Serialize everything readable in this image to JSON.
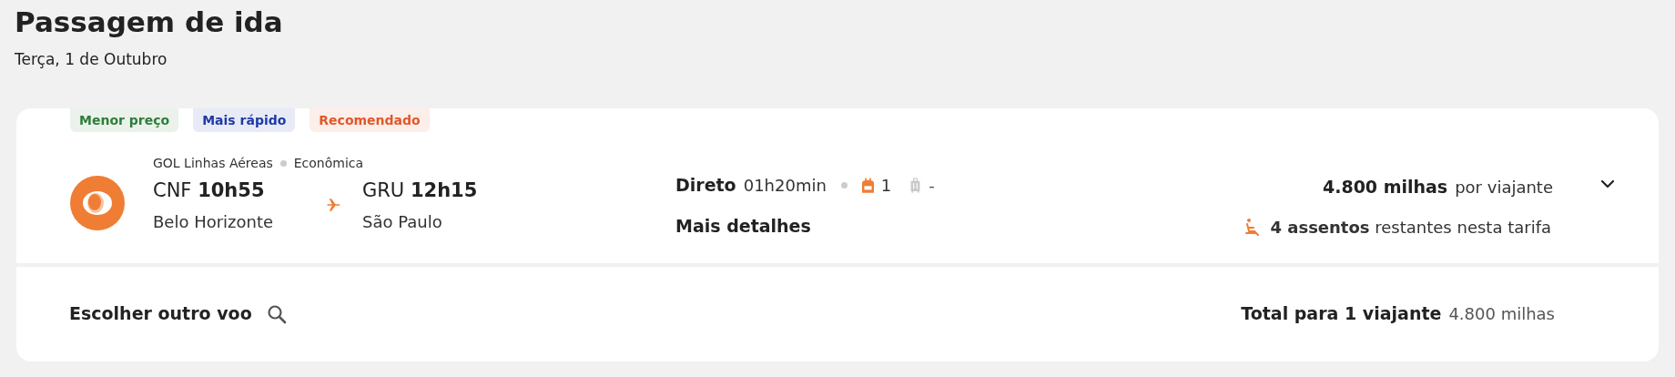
{
  "header": {
    "title": "Passagem de ida",
    "date": "Terça, 1 de Outubro"
  },
  "flight": {
    "tags": [
      {
        "label": "Menor preço",
        "color": "#2e7d3a"
      },
      {
        "label": "Mais rápido",
        "color": "#1f3aa6"
      },
      {
        "label": "Recomendado",
        "color": "#e0582a"
      }
    ],
    "airline": "GOL Linhas Aéreas",
    "cabin": "Econômica",
    "departure": {
      "code": "CNF",
      "time": "10h55",
      "city": "Belo Horizonte"
    },
    "arrival": {
      "code": "GRU",
      "time": "12h15",
      "city": "São Paulo"
    },
    "stops": "Direto",
    "duration": "01h20min",
    "baggage": [
      {
        "kind": "backpack",
        "included": true,
        "count": "1"
      },
      {
        "kind": "suitcase",
        "included": false,
        "count": "-"
      }
    ],
    "details_link": "Mais detalhes",
    "price": "4.800 milhas",
    "price_unit": "por viajante",
    "seats": "**4 assentos** restantes nesta tarifa",
    "expanded": false
  },
  "footer": {
    "change_flight": "Escolher outro voo",
    "total_label": "Total para 1 viajante",
    "total_value": "4.800 milhas"
  }
}
